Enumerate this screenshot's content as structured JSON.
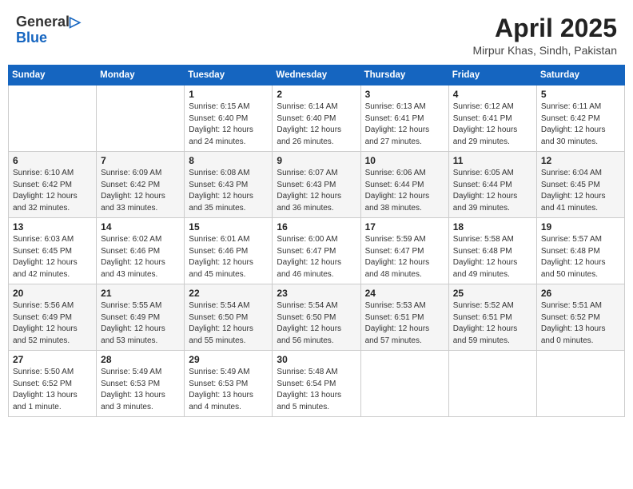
{
  "header": {
    "logo_line1": "General",
    "logo_line2": "Blue",
    "month_title": "April 2025",
    "location": "Mirpur Khas, Sindh, Pakistan"
  },
  "days_of_week": [
    "Sunday",
    "Monday",
    "Tuesday",
    "Wednesday",
    "Thursday",
    "Friday",
    "Saturday"
  ],
  "weeks": [
    [
      {
        "day": "",
        "info": ""
      },
      {
        "day": "",
        "info": ""
      },
      {
        "day": "1",
        "info": "Sunrise: 6:15 AM\nSunset: 6:40 PM\nDaylight: 12 hours\nand 24 minutes."
      },
      {
        "day": "2",
        "info": "Sunrise: 6:14 AM\nSunset: 6:40 PM\nDaylight: 12 hours\nand 26 minutes."
      },
      {
        "day": "3",
        "info": "Sunrise: 6:13 AM\nSunset: 6:41 PM\nDaylight: 12 hours\nand 27 minutes."
      },
      {
        "day": "4",
        "info": "Sunrise: 6:12 AM\nSunset: 6:41 PM\nDaylight: 12 hours\nand 29 minutes."
      },
      {
        "day": "5",
        "info": "Sunrise: 6:11 AM\nSunset: 6:42 PM\nDaylight: 12 hours\nand 30 minutes."
      }
    ],
    [
      {
        "day": "6",
        "info": "Sunrise: 6:10 AM\nSunset: 6:42 PM\nDaylight: 12 hours\nand 32 minutes."
      },
      {
        "day": "7",
        "info": "Sunrise: 6:09 AM\nSunset: 6:42 PM\nDaylight: 12 hours\nand 33 minutes."
      },
      {
        "day": "8",
        "info": "Sunrise: 6:08 AM\nSunset: 6:43 PM\nDaylight: 12 hours\nand 35 minutes."
      },
      {
        "day": "9",
        "info": "Sunrise: 6:07 AM\nSunset: 6:43 PM\nDaylight: 12 hours\nand 36 minutes."
      },
      {
        "day": "10",
        "info": "Sunrise: 6:06 AM\nSunset: 6:44 PM\nDaylight: 12 hours\nand 38 minutes."
      },
      {
        "day": "11",
        "info": "Sunrise: 6:05 AM\nSunset: 6:44 PM\nDaylight: 12 hours\nand 39 minutes."
      },
      {
        "day": "12",
        "info": "Sunrise: 6:04 AM\nSunset: 6:45 PM\nDaylight: 12 hours\nand 41 minutes."
      }
    ],
    [
      {
        "day": "13",
        "info": "Sunrise: 6:03 AM\nSunset: 6:45 PM\nDaylight: 12 hours\nand 42 minutes."
      },
      {
        "day": "14",
        "info": "Sunrise: 6:02 AM\nSunset: 6:46 PM\nDaylight: 12 hours\nand 43 minutes."
      },
      {
        "day": "15",
        "info": "Sunrise: 6:01 AM\nSunset: 6:46 PM\nDaylight: 12 hours\nand 45 minutes."
      },
      {
        "day": "16",
        "info": "Sunrise: 6:00 AM\nSunset: 6:47 PM\nDaylight: 12 hours\nand 46 minutes."
      },
      {
        "day": "17",
        "info": "Sunrise: 5:59 AM\nSunset: 6:47 PM\nDaylight: 12 hours\nand 48 minutes."
      },
      {
        "day": "18",
        "info": "Sunrise: 5:58 AM\nSunset: 6:48 PM\nDaylight: 12 hours\nand 49 minutes."
      },
      {
        "day": "19",
        "info": "Sunrise: 5:57 AM\nSunset: 6:48 PM\nDaylight: 12 hours\nand 50 minutes."
      }
    ],
    [
      {
        "day": "20",
        "info": "Sunrise: 5:56 AM\nSunset: 6:49 PM\nDaylight: 12 hours\nand 52 minutes."
      },
      {
        "day": "21",
        "info": "Sunrise: 5:55 AM\nSunset: 6:49 PM\nDaylight: 12 hours\nand 53 minutes."
      },
      {
        "day": "22",
        "info": "Sunrise: 5:54 AM\nSunset: 6:50 PM\nDaylight: 12 hours\nand 55 minutes."
      },
      {
        "day": "23",
        "info": "Sunrise: 5:54 AM\nSunset: 6:50 PM\nDaylight: 12 hours\nand 56 minutes."
      },
      {
        "day": "24",
        "info": "Sunrise: 5:53 AM\nSunset: 6:51 PM\nDaylight: 12 hours\nand 57 minutes."
      },
      {
        "day": "25",
        "info": "Sunrise: 5:52 AM\nSunset: 6:51 PM\nDaylight: 12 hours\nand 59 minutes."
      },
      {
        "day": "26",
        "info": "Sunrise: 5:51 AM\nSunset: 6:52 PM\nDaylight: 13 hours\nand 0 minutes."
      }
    ],
    [
      {
        "day": "27",
        "info": "Sunrise: 5:50 AM\nSunset: 6:52 PM\nDaylight: 13 hours\nand 1 minute."
      },
      {
        "day": "28",
        "info": "Sunrise: 5:49 AM\nSunset: 6:53 PM\nDaylight: 13 hours\nand 3 minutes."
      },
      {
        "day": "29",
        "info": "Sunrise: 5:49 AM\nSunset: 6:53 PM\nDaylight: 13 hours\nand 4 minutes."
      },
      {
        "day": "30",
        "info": "Sunrise: 5:48 AM\nSunset: 6:54 PM\nDaylight: 13 hours\nand 5 minutes."
      },
      {
        "day": "",
        "info": ""
      },
      {
        "day": "",
        "info": ""
      },
      {
        "day": "",
        "info": ""
      }
    ]
  ]
}
